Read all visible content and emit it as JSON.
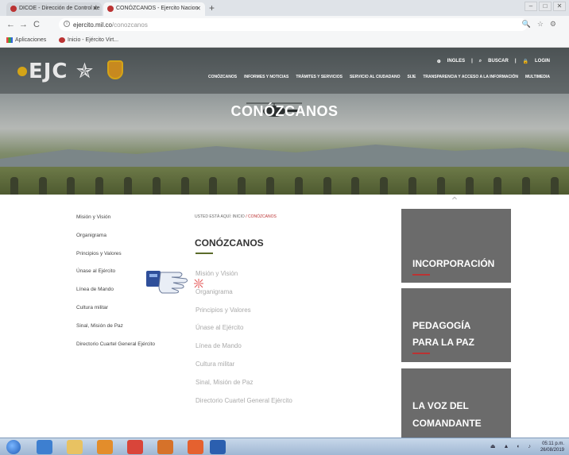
{
  "browser": {
    "tabs": [
      {
        "title": "DICOE - Dirección de Control de"
      },
      {
        "title": "CONÓZCANOS - Ejercito Nacion"
      }
    ],
    "url_host": "ejercito.mil.co",
    "url_path": "/conozcanos",
    "bookmarks": [
      {
        "label": "Aplicaciones"
      },
      {
        "label": "Inicio - Ejército Virt..."
      }
    ]
  },
  "site": {
    "logo_text": "EJC",
    "utility_links": [
      "INGLES",
      "BUSCAR",
      "LOGIN"
    ],
    "nav": [
      "CONÓZCANOS",
      "INFORMES Y NOTICIAS",
      "TRÁMITES Y SERVICIOS",
      "SERVICIO AL CIUDADANO",
      "SIJE",
      "TRANSPARENCIA Y ACCESO A LA INFORMACIÓN",
      "MULTIMEDIA"
    ],
    "hero_title": "CONÓZCANOS"
  },
  "sidemenu": [
    "Misión y Visión",
    "Organigrama",
    "Principios y Valores",
    "Únase al Ejército",
    "Línea de Mando",
    "Cultura militar",
    "Sinal, Misión de Paz",
    "Directorio Cuartel General Ejército"
  ],
  "breadcrumb": {
    "prefix": "USTED ESTÁ AQUÍ:",
    "home": "INICIO",
    "current": "/ CONÓZCANOS"
  },
  "section_title": "CONÓZCANOS",
  "content_list": [
    "Misión y Visión",
    "Organigrama",
    "Principios y Valores",
    "Únase al Ejército",
    "Línea de Mando",
    "Cultura militar",
    "Sinal, Misión de Paz",
    "Directorio Cuartel General Ejército"
  ],
  "cards": [
    {
      "line1": "INCORPORACIÓN",
      "line2": ""
    },
    {
      "line1": "PEDAGOGÍA",
      "line2": "PARA LA PAZ"
    },
    {
      "line1": "LA VOZ DEL",
      "line2": "COMANDANTE"
    }
  ],
  "taskbar": {
    "time": "05:11 p.m.",
    "date": "26/08/2019"
  },
  "colors": {
    "accent_red": "#b33333",
    "accent_green": "#5b6b2a",
    "card_gray": "#6b6b6b"
  }
}
